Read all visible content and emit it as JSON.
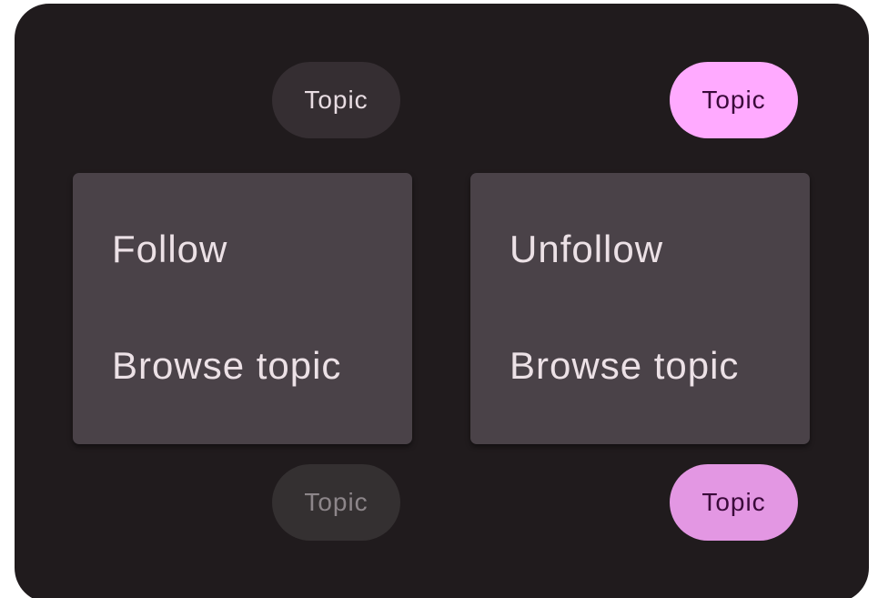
{
  "colors": {
    "panel_background": "#201b1d",
    "menu_background": "#4a4248",
    "chip_default": "#352e32",
    "chip_selected": "#ffaaff",
    "chip_disabled": "#343031",
    "chip_selected_disabled": "#e397e3"
  },
  "chips": {
    "unselected": {
      "label": "Topic"
    },
    "selected": {
      "label": "Topic"
    },
    "unselected_disabled": {
      "label": "Topic"
    },
    "selected_disabled": {
      "label": "Topic"
    }
  },
  "menus": {
    "follow_menu": {
      "items": [
        {
          "label": "Follow"
        },
        {
          "label": "Browse topic"
        }
      ]
    },
    "unfollow_menu": {
      "items": [
        {
          "label": "Unfollow"
        },
        {
          "label": "Browse topic"
        }
      ]
    }
  }
}
